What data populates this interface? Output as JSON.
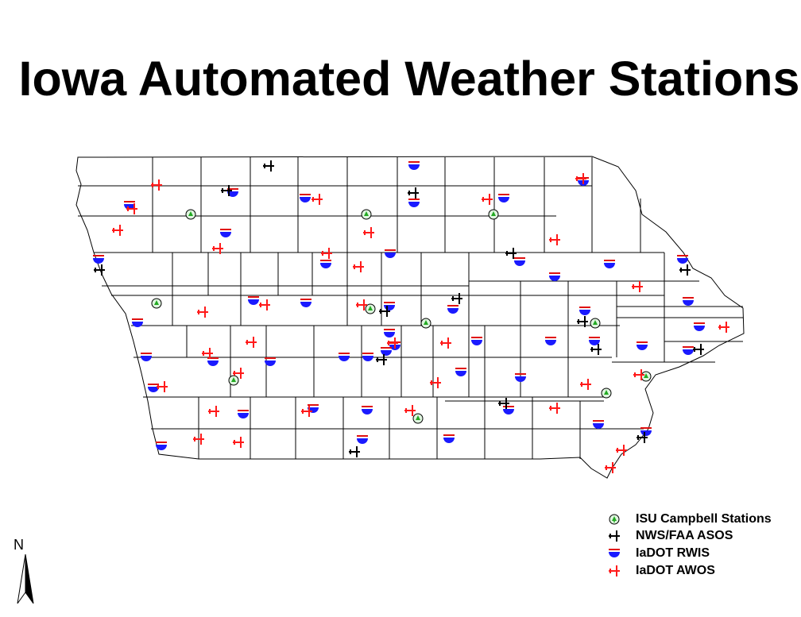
{
  "title": "Iowa Automated Weather Stations",
  "north_label": "N",
  "colors": {
    "rwis_blue": "#1a1aff",
    "rwis_red": "#e01010",
    "awos_red": "#ff1a1a",
    "campbell_green": "#22aa22"
  },
  "legend": [
    {
      "id": "campbell",
      "label": "ISU Campbell Stations",
      "icon": "tree-circle-icon"
    },
    {
      "id": "asos",
      "label": "NWS/FAA ASOS",
      "icon": "black-airplane-icon"
    },
    {
      "id": "rwis",
      "label": "IaDOT RWIS",
      "icon": "blue-half-disc-icon"
    },
    {
      "id": "awos",
      "label": "IaDOT AWOS",
      "icon": "red-airplane-icon"
    }
  ]
}
